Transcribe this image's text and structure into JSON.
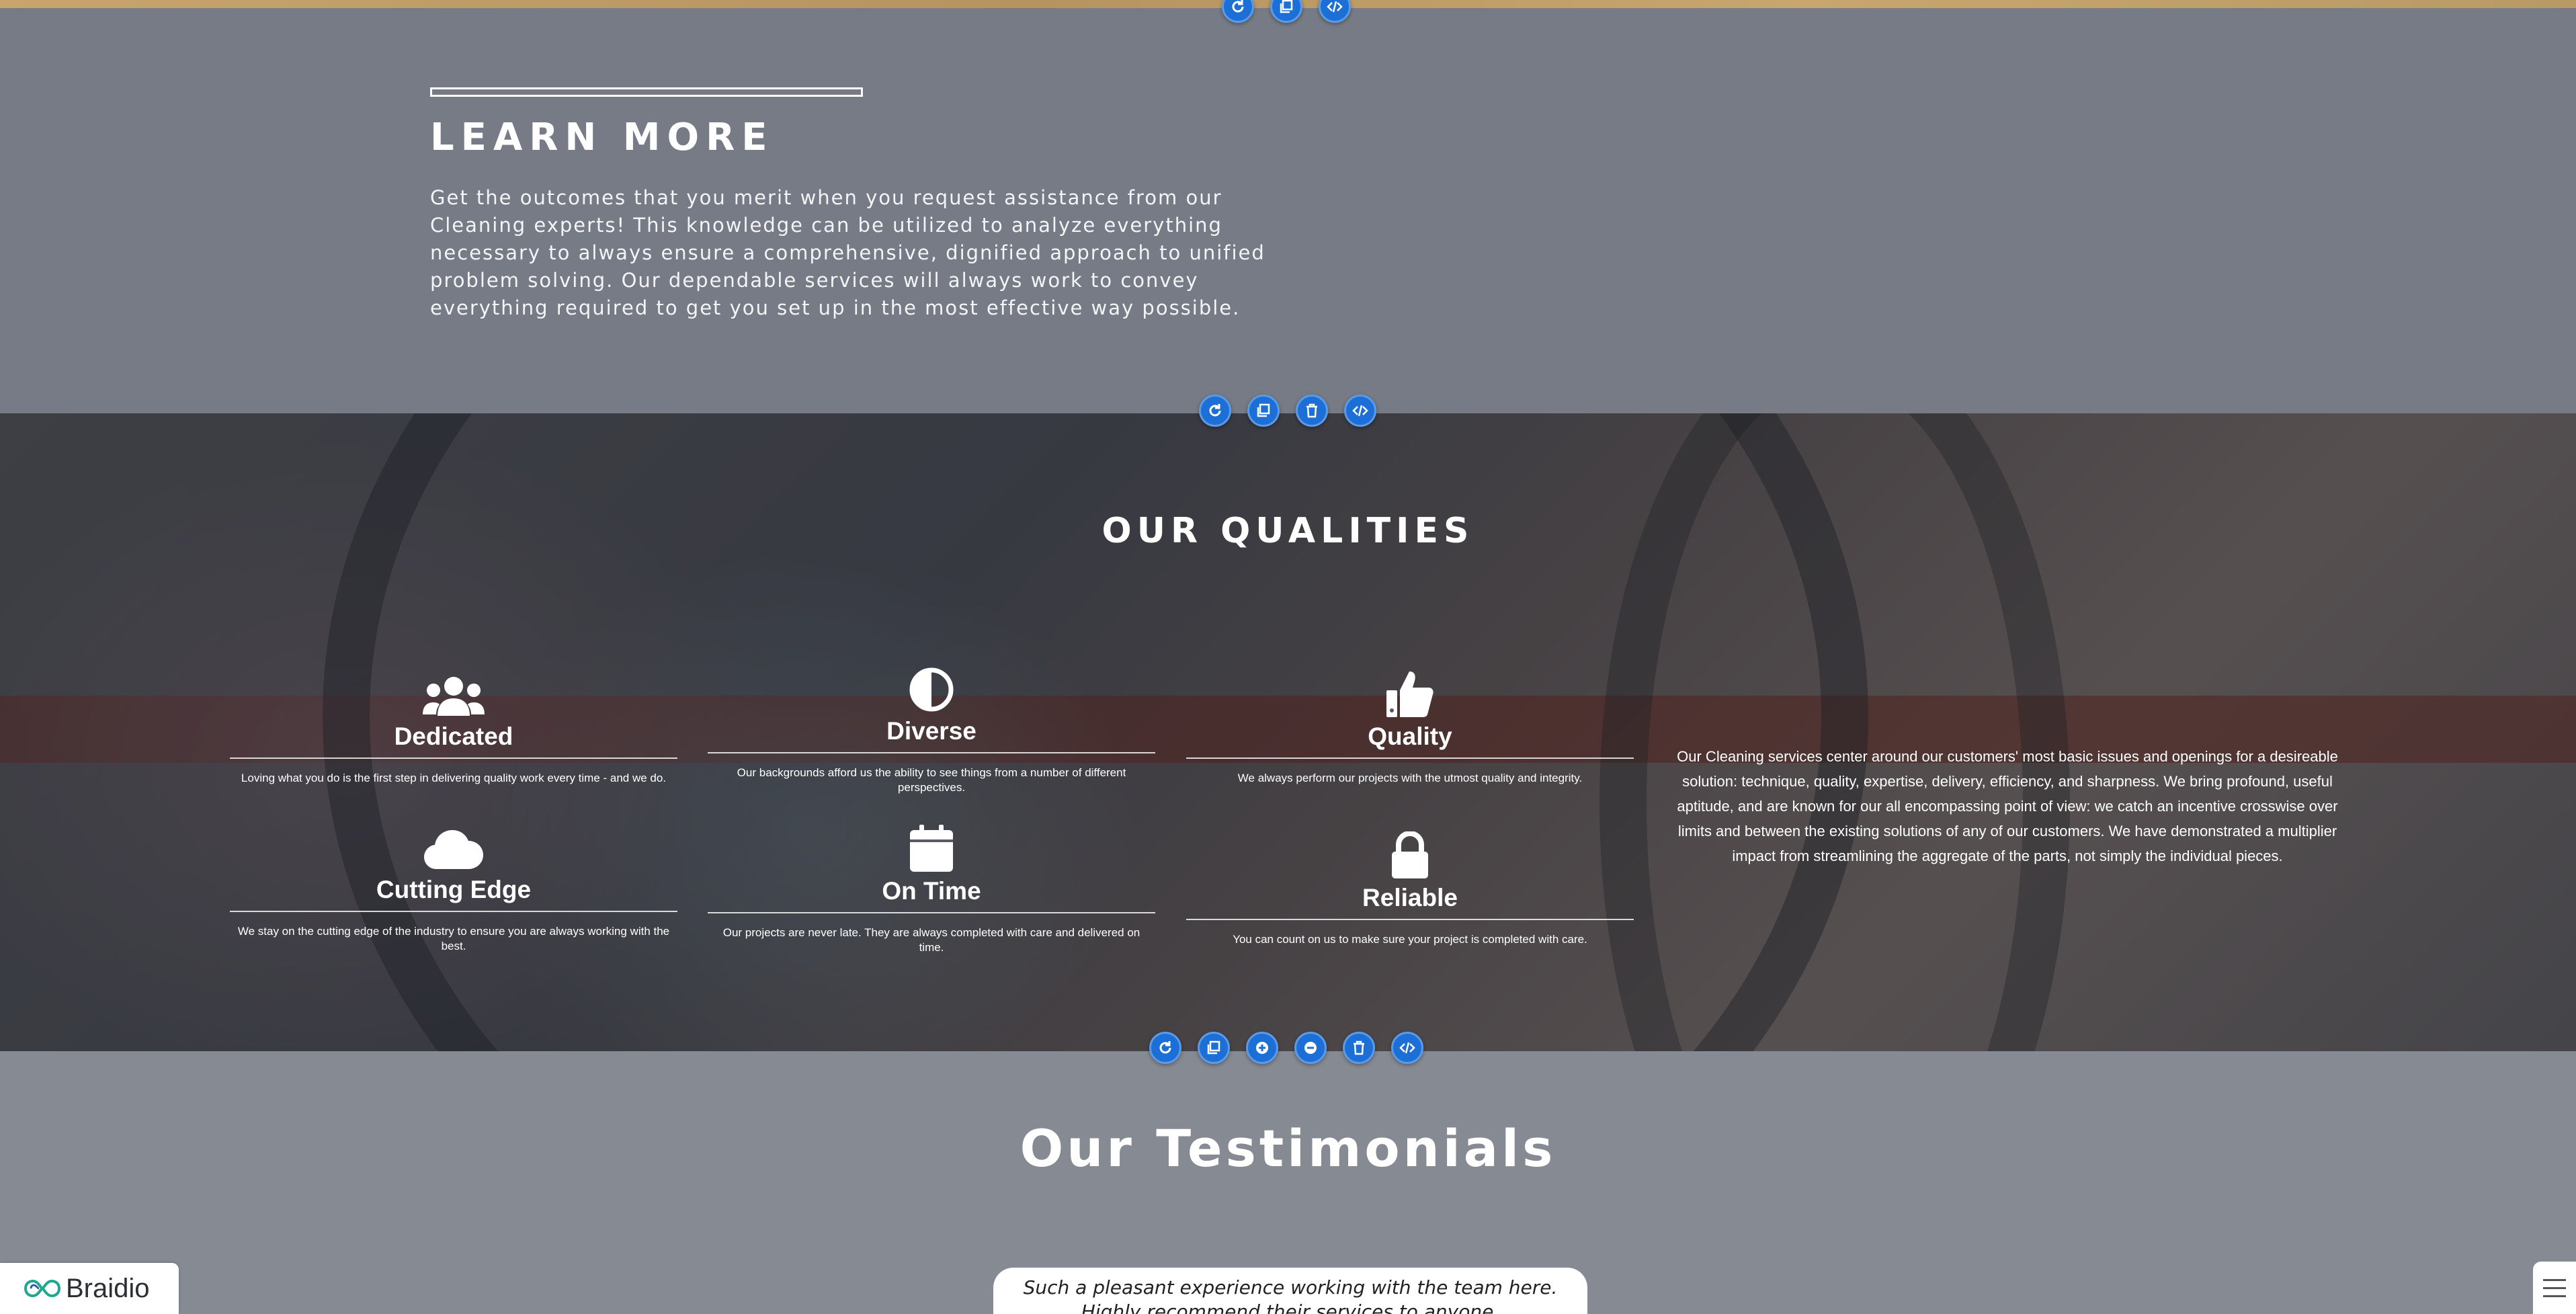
{
  "learn": {
    "title": "LEARN MORE",
    "body": "Get the outcomes that you merit when you request assistance from our Cleaning experts! This knowledge can be utilized to analyze everything necessary to always ensure a comprehensive, dignified approach to unified problem solving. Our dependable services will always work to convey everything required to get you set up in the most effective way possible."
  },
  "qualities": {
    "title": "OUR QUALITIES",
    "items": [
      {
        "icon": "users-icon",
        "title": "Dedicated",
        "text": "Loving what you do is the first step in delivering quality work every time - and we do."
      },
      {
        "icon": "half-circle-icon",
        "title": "Diverse",
        "text": "Our backgrounds afford us the ability to see things from a number of different perspectives."
      },
      {
        "icon": "thumbs-up-icon",
        "title": "Quality",
        "text": "We always perform our projects with the utmost quality and integrity."
      },
      {
        "icon": "cloud-icon",
        "title": "Cutting Edge",
        "text": "We stay on the cutting edge of the industry to ensure you are always working with the best."
      },
      {
        "icon": "calendar-icon",
        "title": "On Time",
        "text": "Our projects are never late. They are always completed with care and delivered on time."
      },
      {
        "icon": "lock-icon",
        "title": "Reliable",
        "text": "You can count on us to make sure your project is completed with care."
      }
    ],
    "description": "Our Cleaning services center around our customers' most basic issues and openings for a desireable solution: technique, quality, expertise, delivery, efficiency, and sharpness. We bring profound, useful aptitude, and are known for our all encompassing point of view: we catch an incentive crosswise over limits and between the existing solutions of any of our customers. We have demonstrated a multiplier impact from streamlining the aggregate of the parts, not simply the individual pieces."
  },
  "testimonials": {
    "title": "Our Testimonials",
    "quote": "Such a pleasant experience working with the team here. Highly recommend their services to anyone."
  },
  "brand": {
    "name": "Braidio"
  },
  "colors": {
    "toolbar_button": "#1c6fd6",
    "section_gray": "#767b85"
  }
}
